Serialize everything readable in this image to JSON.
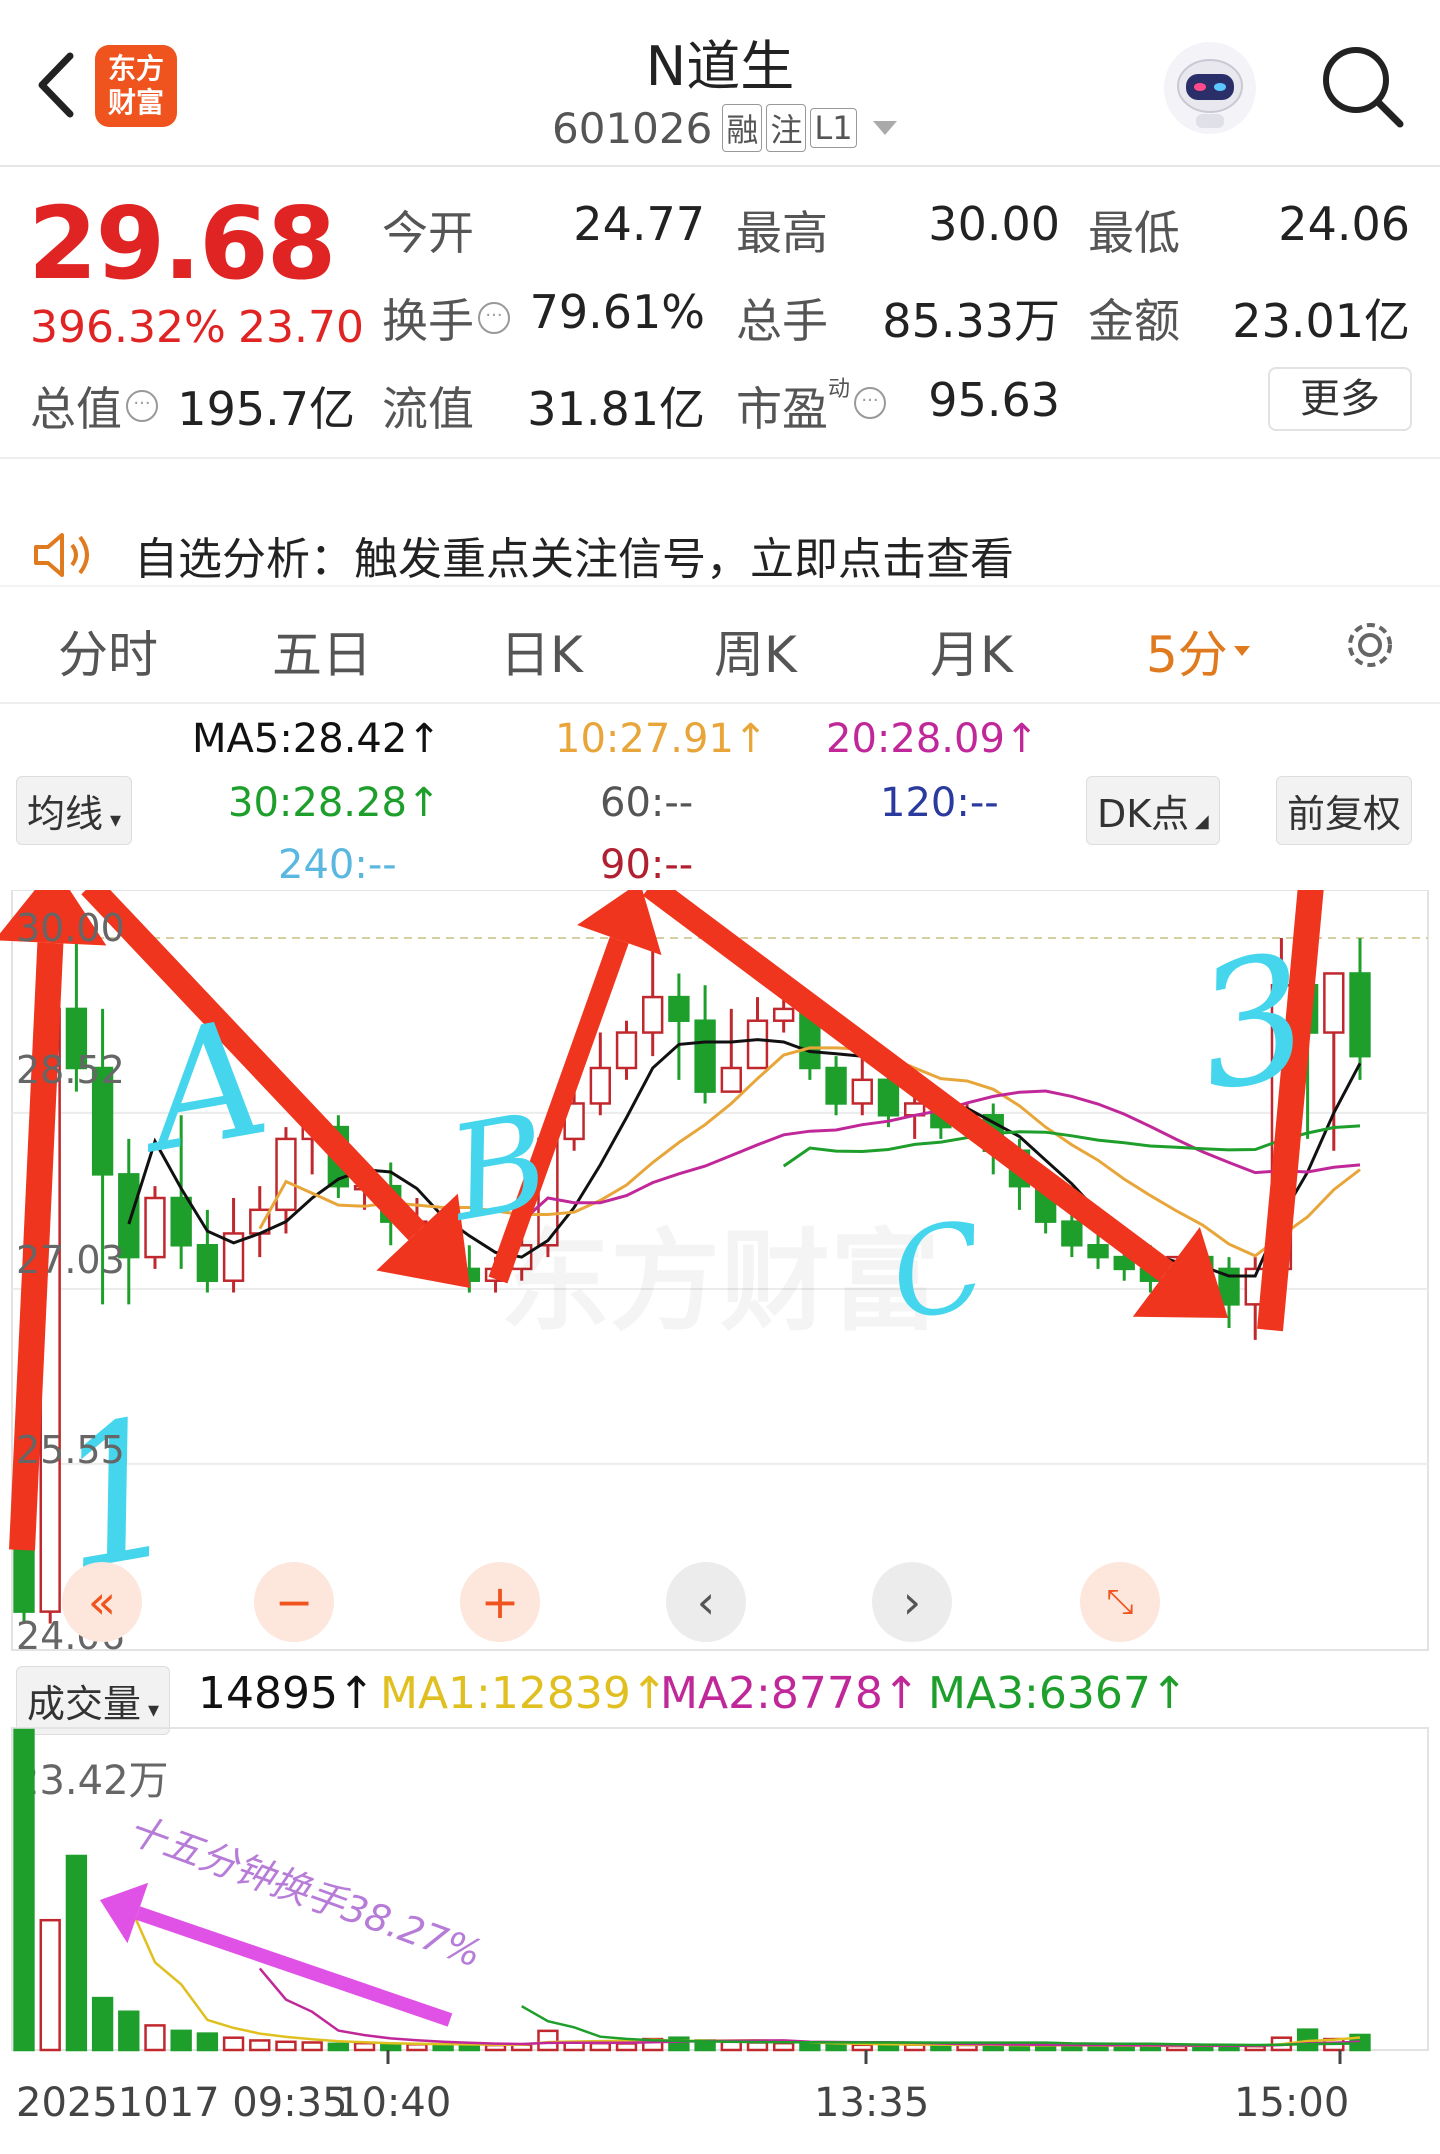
{
  "header": {
    "title": "N道生",
    "code": "601026",
    "badges": [
      "融",
      "注",
      "L1"
    ],
    "logo_text": "东方财富"
  },
  "quote": {
    "price": "29.68",
    "change_pct": "396.32%",
    "change": "23.70",
    "rows": [
      [
        {
          "label": "今开",
          "value": "24.77",
          "color": "red"
        },
        {
          "label": "最高",
          "value": "30.00",
          "color": "red"
        },
        {
          "label": "最低",
          "value": "24.06",
          "color": "red"
        }
      ],
      [
        {
          "label": "换手",
          "value": "79.61%",
          "color": "black"
        },
        {
          "label": "总手",
          "value": "85.33万",
          "color": "black"
        },
        {
          "label": "金额",
          "value": "23.01亿",
          "color": "black"
        }
      ],
      [
        {
          "label": "总值",
          "value": "195.7亿",
          "color": "black"
        },
        {
          "label": "流值",
          "value": "31.81亿",
          "color": "black"
        },
        {
          "label": "市盈",
          "value": "95.63",
          "color": "black"
        }
      ]
    ],
    "pe_superscript": "动",
    "more_label": "更多"
  },
  "notice": "自选分析：触发重点关注信号，立即点击查看",
  "tabs": [
    "分时",
    "五日",
    "日K",
    "周K",
    "月K",
    "5分"
  ],
  "active_tab": "5分",
  "ma_panel": {
    "selector": "均线",
    "ma5": "MA5:28.42",
    "ma10": "10:27.91",
    "ma20": "20:28.09",
    "ma30": "30:28.28",
    "ma60": "60:--",
    "ma120": "120:--",
    "ma240": "240:--",
    "ma90": "90:--",
    "dk_label": "DK点",
    "fq_label": "前复权"
  },
  "price_axis": [
    "30.00",
    "28.52",
    "27.03",
    "25.55",
    "24.06"
  ],
  "annotations": {
    "letters": [
      "A",
      "B",
      "C"
    ],
    "numbers": [
      "1",
      "3"
    ],
    "watermark": "东方财富",
    "volume_note": "十五分钟换手38.27%"
  },
  "volume_panel": {
    "selector": "成交量",
    "current": "14895",
    "ma1": "MA1:12839",
    "ma2": "MA2:8778",
    "ma3": "MA3:6367",
    "max_label": "23.42万"
  },
  "time_axis": [
    "20251017 09:35",
    "10:40",
    "13:35",
    "15:00"
  ],
  "colors": {
    "up": "#c0282d",
    "down": "#1e9e2b",
    "ma5": "#111111",
    "ma10": "#e8a63a",
    "ma20": "#c0289a",
    "ma30": "#1e9e2b",
    "arrow": "#f0351e",
    "cyan": "#45d6ee",
    "magenta": "#e052e6",
    "accent_orange": "#e07a1f"
  }
}
